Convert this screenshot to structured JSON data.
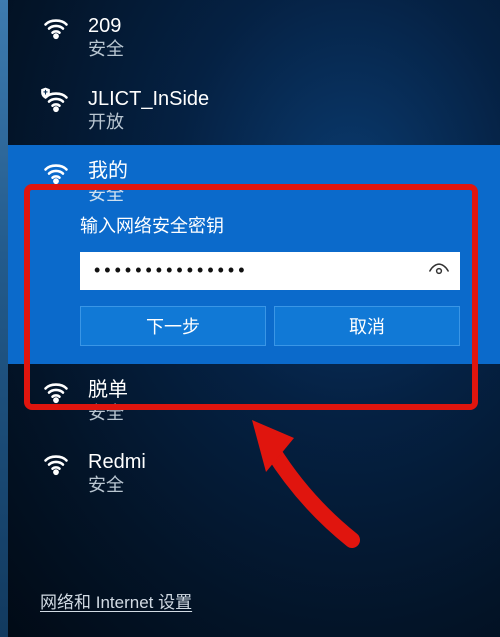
{
  "networks": {
    "n0": {
      "ssid": "209",
      "status": "安全",
      "shield": false
    },
    "n1": {
      "ssid": "JLICT_InSide",
      "status": "开放",
      "shield": true
    },
    "active": {
      "ssid": "我的",
      "status": "安全",
      "shield": false
    },
    "n3": {
      "ssid": "脱单",
      "status": "安全",
      "shield": false
    },
    "n4": {
      "ssid": "Redmi",
      "status": "安全",
      "shield": false
    }
  },
  "connect": {
    "prompt": "输入网络安全密钥",
    "password_mask": "●●●●●●●●●●●●●●●",
    "next_label": "下一步",
    "cancel_label": "取消"
  },
  "footer": {
    "link": "网络和 Internet 设置"
  },
  "icons": {
    "wifi": "wifi-icon",
    "wifi_shield": "wifi-shield-icon",
    "eye": "reveal-password-icon"
  },
  "annotation": {
    "highlight": "red-box",
    "arrow": "red-arrow"
  }
}
